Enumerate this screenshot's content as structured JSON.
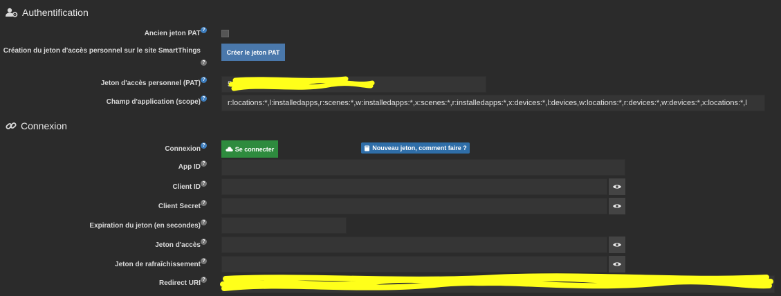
{
  "auth": {
    "title": "Authentification",
    "legacy_pat_label": "Ancien jeton PAT",
    "create_pat_label": "Création du jeton d'accès personnel sur le site SmartThings",
    "create_pat_button": "Créer le jeton PAT",
    "pat_label": "Jeton d'accès personnel (PAT)",
    "pat_value": "5",
    "scope_label": "Champ d'application (scope)",
    "scope_value": "r:locations:*,l:installedapps,r:scenes:*,w:installedapps:*,x:scenes:*,r:installedapps:*,x:devices:*,l:devices,w:locations:*,r:devices:*,w:devices:*,x:locations:*,l"
  },
  "connexion": {
    "title": "Connexion",
    "connect_label": "Connexion",
    "connect_button": "Se connecter",
    "new_token_link": "Nouveau jeton, comment faire ?",
    "app_id_label": "App ID",
    "client_id_label": "Client ID",
    "client_secret_label": "Client Secret",
    "expiration_label": "Expiration du jeton (en secondes)",
    "access_token_label": "Jeton d'accès",
    "refresh_token_label": "Jeton de rafraîchissement",
    "redirect_uri_label": "Redirect URI"
  },
  "colors": {
    "background": "#2b2b2b",
    "primary_button": "#4a78ab",
    "success_button": "#2e8b3e",
    "info_badge": "#2f6ea8",
    "redaction": "#ffff1a"
  },
  "icons": {
    "auth": "user-gear-icon",
    "connexion": "link-icon",
    "help": "question-circle-icon",
    "show": "eye-icon",
    "connect": "cloud-icon",
    "book": "book-icon"
  }
}
